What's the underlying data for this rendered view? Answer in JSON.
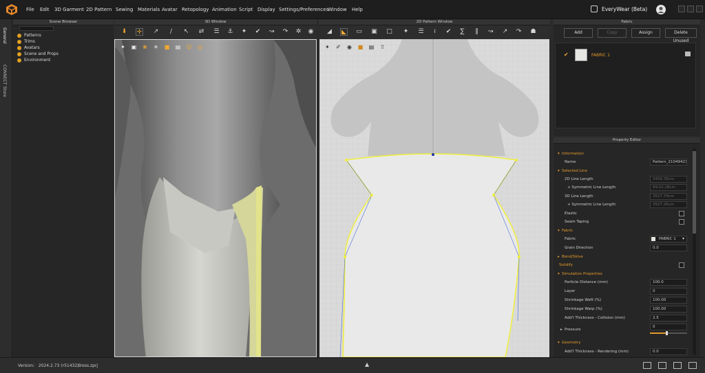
{
  "app": {
    "brand": "EveryWear (Beta)"
  },
  "menu": [
    "File",
    "Edit",
    "3D Garment",
    "2D Pattern",
    "Sewing",
    "Materials",
    "Avatar",
    "Retopology",
    "Animation",
    "Script",
    "Display",
    "Settings/Preferences",
    "Window",
    "Help"
  ],
  "side_tabs": [
    "General",
    "CONNECT Store"
  ],
  "scene_browser": {
    "title": "Scene Browser",
    "items": [
      "Patterns",
      "Trims",
      "Avatars",
      "Scene and Props",
      "Environment"
    ]
  },
  "window_3d": {
    "title": "3D Window"
  },
  "window_2d": {
    "title": "2D Pattern Window"
  },
  "fabric_panel": {
    "title": "Fabric",
    "buttons": {
      "add": "Add",
      "copy": "Copy",
      "assign": "Assign",
      "delete_unused": "Delete Unused"
    },
    "items": [
      {
        "name": "FABRIC 1"
      }
    ]
  },
  "property_editor": {
    "title": "Property Editor",
    "information": {
      "section": "Information",
      "name_label": "Name",
      "name_value": "Pattern_21049423"
    },
    "selected_line": {
      "section": "Selected Line",
      "line2d_label": "2D Line Length",
      "line2d_value": "3456.39cm",
      "sym2d_label": "+ Symmetric Line Length",
      "sym2d_value": "69.01.28cm",
      "line3d_label": "3D Line Length",
      "line3d_value": "3527.79cm",
      "sym3d_label": "+ Symmetric Line Length",
      "sym3d_value": "3527.26cm",
      "elastic_label": "Elastic",
      "seam_label": "Seam Taping"
    },
    "fabric": {
      "section": "Fabric",
      "fabric_label": "Fabric",
      "fabric_value": "FABRIC 1",
      "grain_label": "Grain Direction",
      "grain_value": "0.0"
    },
    "bond": {
      "section": "Bond/Skive"
    },
    "solidify": {
      "section": "Solidify"
    },
    "simulation": {
      "section": "Simulation Properties",
      "particle_label": "Particle Distance (mm)",
      "particle_value": "100.0",
      "layer_label": "Layer",
      "layer_value": "0",
      "weft_label": "Shrinkage Weft (%)",
      "weft_value": "100.00",
      "warp_label": "Shrinkage Warp (%)",
      "warp_value": "100.00",
      "collision_label": "Add'l Thickness - Collision (mm)",
      "collision_value": "2.5",
      "pressure_label": "Pressure",
      "pressure_value": "0"
    },
    "geometry": {
      "section": "Geometry",
      "render_label": "Add'l Thickness - Rendering (mm)",
      "render_value": "0.0"
    }
  },
  "status": {
    "version_label": "Version:",
    "version_value": "2024.2.73 (r51432)",
    "file": "dress.zprj"
  }
}
